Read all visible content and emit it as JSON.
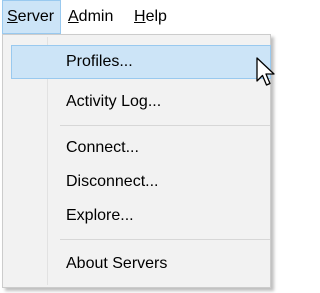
{
  "menubar": {
    "items": [
      {
        "mnemonic": "S",
        "rest": "erver"
      },
      {
        "mnemonic": "A",
        "rest": "dmin"
      },
      {
        "mnemonic": "H",
        "rest": "elp"
      }
    ]
  },
  "server_menu": {
    "items": [
      {
        "label": "Profiles..."
      },
      {
        "label": "Activity Log..."
      },
      {
        "label": "Connect..."
      },
      {
        "label": "Disconnect..."
      },
      {
        "label": "Explore..."
      },
      {
        "label": "About Servers"
      }
    ],
    "highlighted_item": "Profiles..."
  },
  "colors": {
    "highlight_bg": "#cce4f7",
    "highlight_border": "#99c9ef",
    "menu_bg": "#f2f2f2"
  },
  "icons": {
    "cursor": "mouse-pointer-icon"
  }
}
